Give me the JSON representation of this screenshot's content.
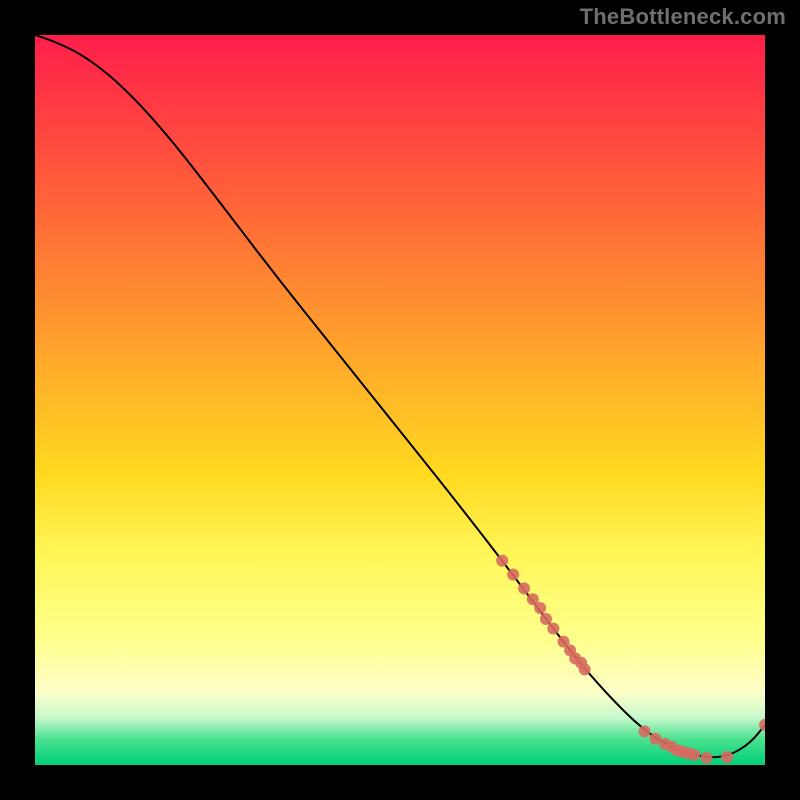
{
  "watermark": "TheBottleneck.com",
  "chart_data": {
    "type": "line",
    "title": "",
    "xlabel": "",
    "ylabel": "",
    "xlim": [
      0,
      100
    ],
    "ylim": [
      0,
      100
    ],
    "grid": false,
    "legend": "none",
    "background_gradient": [
      {
        "stop": 0.0,
        "color": "#ff1e4b"
      },
      {
        "stop": 0.2,
        "color": "#ff5a3a"
      },
      {
        "stop": 0.4,
        "color": "#ff9a2e"
      },
      {
        "stop": 0.6,
        "color": "#ffd91f"
      },
      {
        "stop": 0.72,
        "color": "#fff85c"
      },
      {
        "stop": 0.83,
        "color": "#ffff8e"
      },
      {
        "stop": 0.9,
        "color": "#fdffc8"
      },
      {
        "stop": 0.935,
        "color": "#c7f8cc"
      },
      {
        "stop": 0.965,
        "color": "#49e18f"
      },
      {
        "stop": 1.0,
        "color": "#00cf7a"
      }
    ],
    "series": [
      {
        "name": "bottleneck-curve",
        "type": "line",
        "color": "#000000",
        "x": [
          0,
          3,
          7,
          12,
          18,
          25,
          33,
          41,
          49,
          57,
          64,
          70,
          75,
          80,
          84,
          88,
          92,
          95,
          98,
          100
        ],
        "y": [
          100,
          99,
          97,
          93,
          86.5,
          77.5,
          67,
          57,
          47,
          37,
          28,
          20,
          13.5,
          8,
          4.3,
          2.0,
          1.0,
          1.2,
          3.0,
          5.5
        ]
      },
      {
        "name": "markers-upper",
        "type": "scatter",
        "color": "#d86a5f",
        "radius": 6,
        "x": [
          64.0,
          65.5,
          67.0,
          68.2,
          69.2,
          70.0,
          71.0,
          72.4,
          73.3,
          74.0,
          74.8,
          75.3
        ],
        "y": [
          28.0,
          26.1,
          24.2,
          22.7,
          21.5,
          20.0,
          18.7,
          16.9,
          15.7,
          14.6,
          14.0,
          13.1
        ]
      },
      {
        "name": "markers-lower",
        "type": "scatter",
        "color": "#d86a5f",
        "radius": 6,
        "x": [
          83.5,
          85.0,
          86.3,
          87.2,
          88.0,
          88.8,
          89.5,
          90.3,
          92.0,
          94.8,
          100.0
        ],
        "y": [
          4.6,
          3.6,
          2.9,
          2.5,
          2.0,
          1.8,
          1.6,
          1.4,
          1.0,
          1.1,
          5.5
        ]
      }
    ]
  }
}
